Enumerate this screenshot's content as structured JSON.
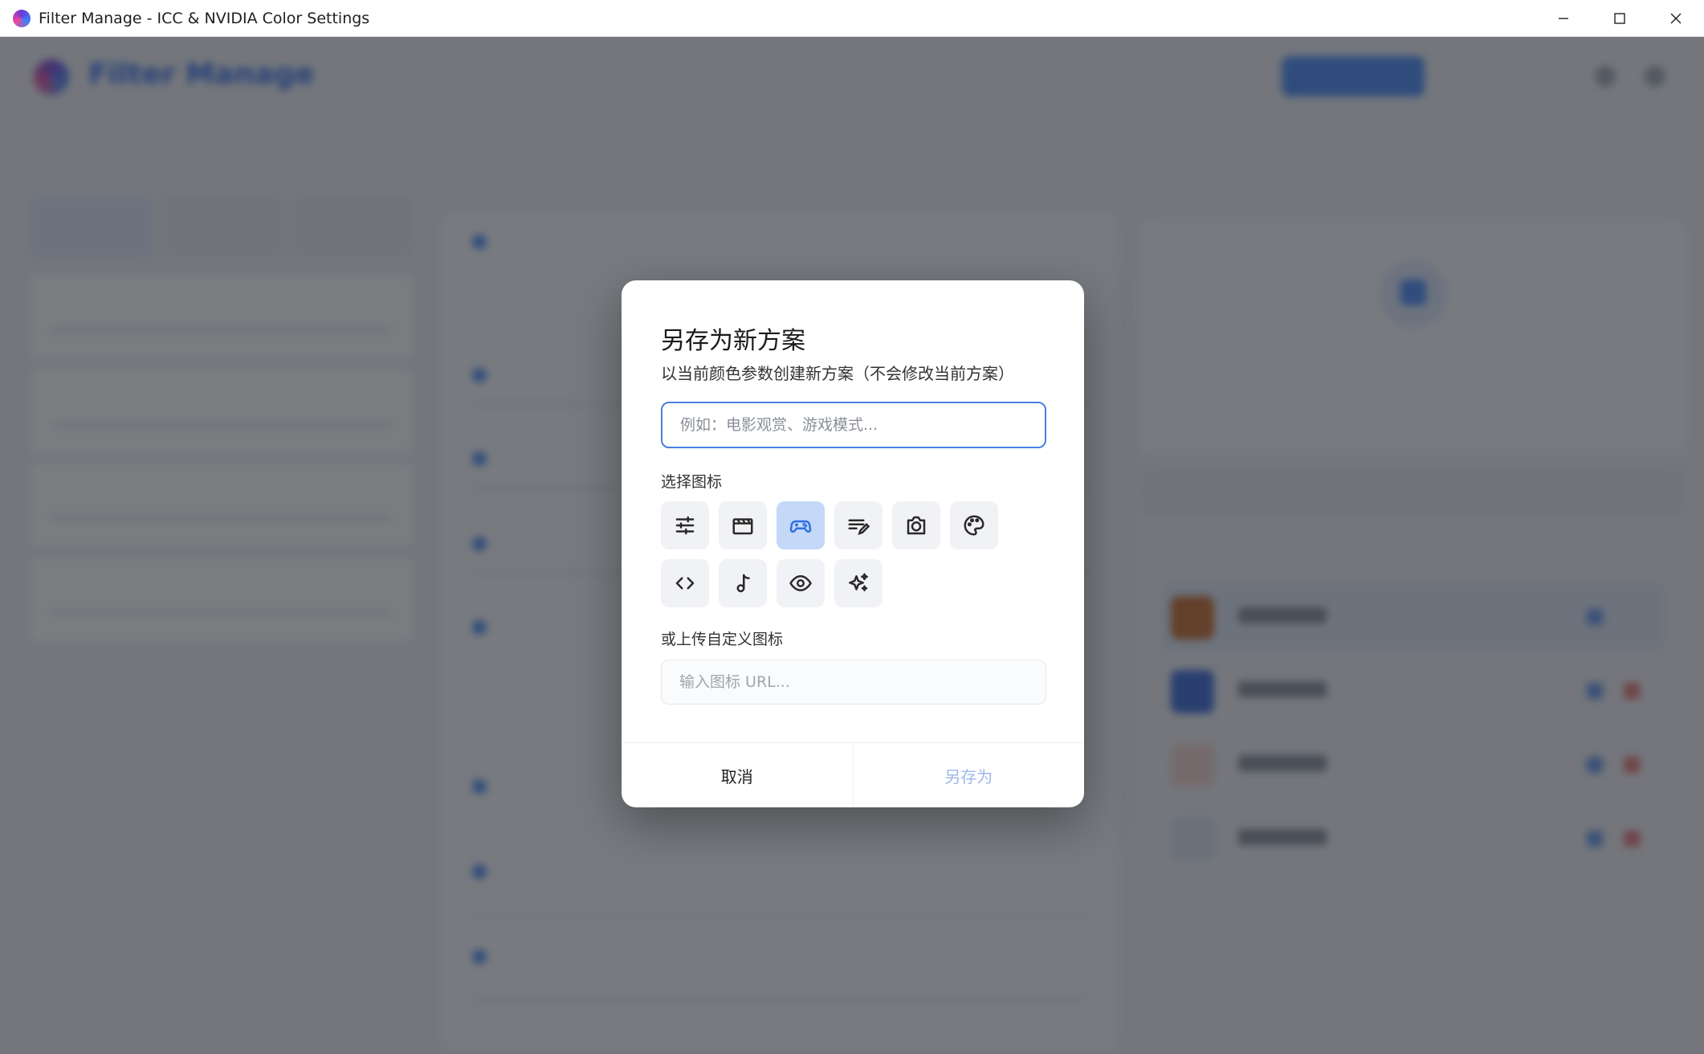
{
  "window": {
    "title": "Filter Manage - ICC & NVIDIA Color Settings",
    "controls": [
      "minimize-icon",
      "maximize-icon",
      "close-icon"
    ]
  },
  "dialog": {
    "title": "另存为新方案",
    "subtitle": "以当前颜色参数创建新方案（不会修改当前方案）",
    "name_input": {
      "value": "",
      "placeholder": "例如：电影观赏、游戏模式..."
    },
    "icon_section_label": "选择图标",
    "icons": [
      {
        "name": "tune-icon",
        "selected": false
      },
      {
        "name": "movie-icon",
        "selected": false
      },
      {
        "name": "gamepad-icon",
        "selected": true
      },
      {
        "name": "notes-edit-icon",
        "selected": false
      },
      {
        "name": "camera-icon",
        "selected": false
      },
      {
        "name": "palette-icon",
        "selected": false
      },
      {
        "name": "code-icon",
        "selected": false
      },
      {
        "name": "music-note-icon",
        "selected": false
      },
      {
        "name": "eye-icon",
        "selected": false
      },
      {
        "name": "sparkles-icon",
        "selected": false
      }
    ],
    "custom_icon_label": "或上传自定义图标",
    "url_input": {
      "value": "",
      "placeholder": "输入图标 URL..."
    },
    "cancel_label": "取消",
    "save_label": "另存为",
    "colors": {
      "accent": "#4a7fe0",
      "selected_icon_bg": "#c4d8f7",
      "save_disabled": "#9db8ea"
    }
  }
}
